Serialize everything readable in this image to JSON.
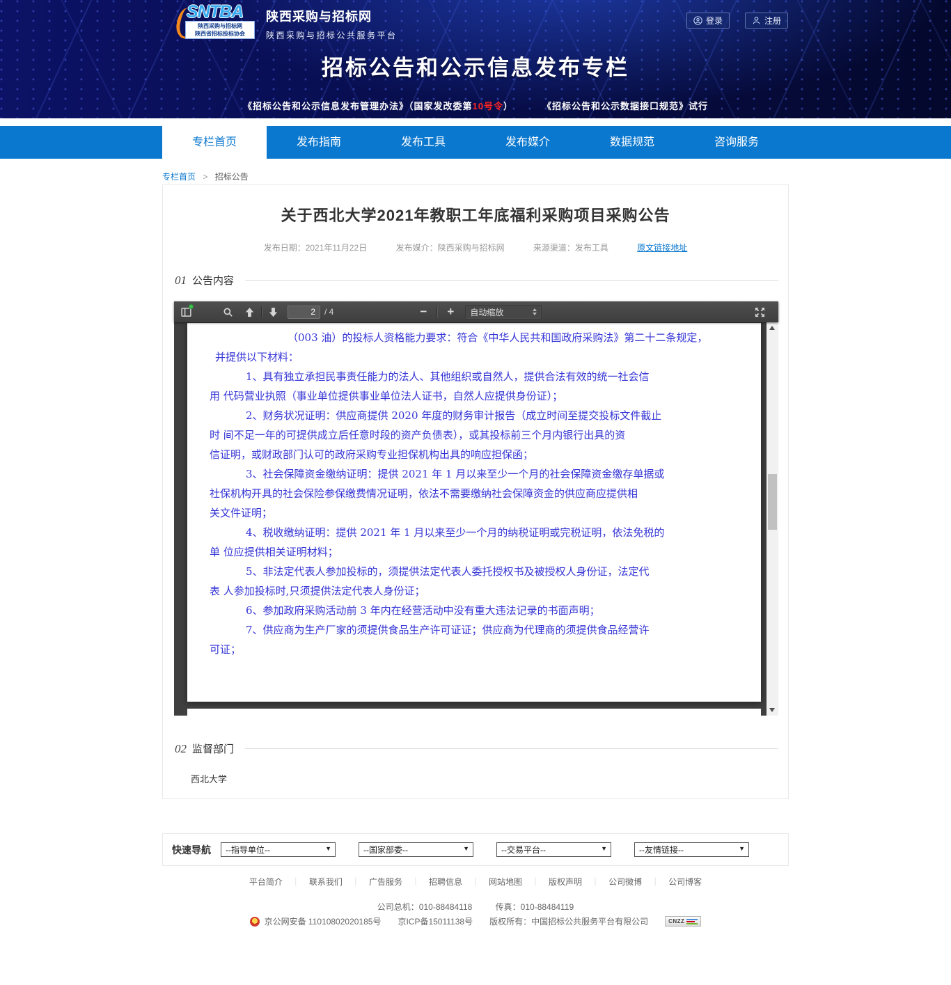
{
  "colors": {
    "nav_blue": "#0b78cf",
    "banner_navy": "#070d49",
    "pdf_text_blue": "#3434d6",
    "highlight_red": "#ff2525"
  },
  "header": {
    "logo_brand": "SNTBA",
    "logo_seal_line1": "陕西采购与招标网",
    "logo_seal_line2": "陕西省招标投标协会",
    "logo_title": "陕西采购与招标网",
    "logo_subtitle": "陕西采购与招标公共服务平台",
    "login_label": "登录",
    "register_label": "注册",
    "banner_title": "招标公告和公示信息发布专栏",
    "reg1_prefix": "《招标公告和公示信息发布管理办法》（国家发改委第",
    "reg1_red": "10号令",
    "reg1_suffix": "）",
    "reg2": "《招标公告和公示数据接口规范》试行"
  },
  "nav": {
    "tabs": [
      {
        "label": "专栏首页"
      },
      {
        "label": "发布指南"
      },
      {
        "label": "发布工具"
      },
      {
        "label": "发布媒介"
      },
      {
        "label": "数据规范"
      },
      {
        "label": "咨询服务"
      }
    ]
  },
  "breadcrumb": {
    "home": "专栏首页",
    "separator": ">",
    "current": "招标公告"
  },
  "article": {
    "title": "关于西北大学2021年教职工年底福利采购项目采购公告",
    "meta_date": "发布日期：2021年11月22日",
    "meta_media": "发布媒介：陕西采购与招标网",
    "meta_source": "来源渠道：发布工具",
    "meta_link": "原文链接地址",
    "section1_no": "01",
    "section1_title": "公告内容",
    "section2_no": "02",
    "section2_title": "监督部门",
    "supervisor": "西北大学"
  },
  "pdf_viewer": {
    "page_input": "2",
    "page_total": "/ 4",
    "zoom_out_glyph": "−",
    "zoom_in_glyph": "+",
    "zoom_select": "自动缩放",
    "lines": [
      "（003 油）的投标人资格能力要求：符合《中华人民共和国政府采购法》第二十二条规定，",
      "并提供以下材料：",
      "1、具有独立承担民事责任能力的法人、其他组织或自然人，提供合法有效的统一社会信",
      "用 代码营业执照（事业单位提供事业单位法人证书，自然人应提供身份证）；",
      "2、财务状况证明：供应商提供 2020 年度的财务审计报告（成立时间至提交投标文件截止",
      "时 间不足一年的可提供成立后任意时段的资产负债表），或其投标前三个月内银行出具的资",
      "信证明，或财政部门认可的政府采购专业担保机构出具的响应担保函；",
      "3、社会保障资金缴纳证明：提供 2021 年 1 月以来至少一个月的社会保障资金缴存单据或",
      "社保机构开具的社会保险参保缴费情况证明，依法不需要缴纳社会保障资金的供应商应提供相",
      "关文件证明；",
      "4、税收缴纳证明：提供 2021 年 1 月以来至少一个月的纳税证明或完税证明，依法免税的",
      "单 位应提供相关证明材料；",
      "5、非法定代表人参加投标的，须提供法定代表人委托授权书及被授权人身份证，法定代",
      "表 人参加投标时,只须提供法定代表人身份证；",
      "6、参加政府采购活动前 3 年内在经营活动中没有重大违法记录的书面声明；",
      "7、供应商为生产厂家的须提供食品生产许可证证；供应商为代理商的须提供食品经营许",
      "可证；"
    ]
  },
  "quicknav": {
    "label": "快速导航",
    "options": [
      "--指导单位--",
      "--国家部委--",
      "--交易平台--",
      "--友情链接--"
    ]
  },
  "footer": {
    "links": [
      "平台简介",
      "联系我们",
      "广告服务",
      "招聘信息",
      "网站地图",
      "版权声明",
      "公司微博",
      "公司博客"
    ],
    "separator": "｜",
    "phone": "公司总机：010-88484118",
    "fax": "传真：010-88484119",
    "police_beian": "京公网安备 11010802020185号",
    "icp_beian": "京ICP备15011138号",
    "copyright": "版权所有：中国招标公共服务平台有限公司",
    "cnzz_label": "CNZZ"
  }
}
